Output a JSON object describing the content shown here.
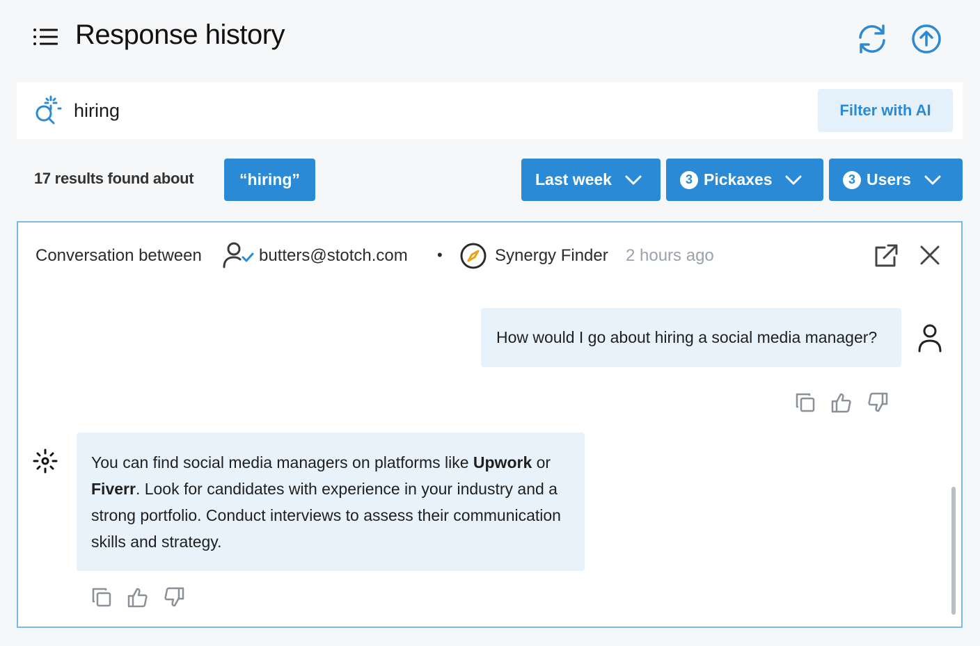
{
  "header": {
    "title": "Response history"
  },
  "search": {
    "value": "hiring",
    "filter_button": "Filter with AI"
  },
  "results": {
    "summary": "17 results found about",
    "query_chip": "“hiring”"
  },
  "filters": {
    "date": {
      "label": "Last week"
    },
    "pickaxes": {
      "count": "3",
      "label": "Pickaxes"
    },
    "users": {
      "count": "3",
      "label": "Users"
    }
  },
  "conversation": {
    "label": "Conversation between",
    "user_email": "butters@stotch.com",
    "separator": "•",
    "pickaxe_name": "Synergy Finder",
    "timestamp": "2 hours ago",
    "user_message": "How would I go about hiring a social media manager?",
    "ai_message": {
      "part1": "You can find social media managers on platforms like ",
      "bold1": "Upwork",
      "part2": " or ",
      "bold2": "Fiverr",
      "part3": ". Look for candidates with experience in your industry and a strong portfolio. Conduct interviews to assess their communication skills and strategy."
    }
  },
  "colors": {
    "accent": "#2a8ad6",
    "bubble": "#e8f2fa",
    "panel_border": "#7ab8e8",
    "pickaxe_badge": "#e8a418"
  }
}
